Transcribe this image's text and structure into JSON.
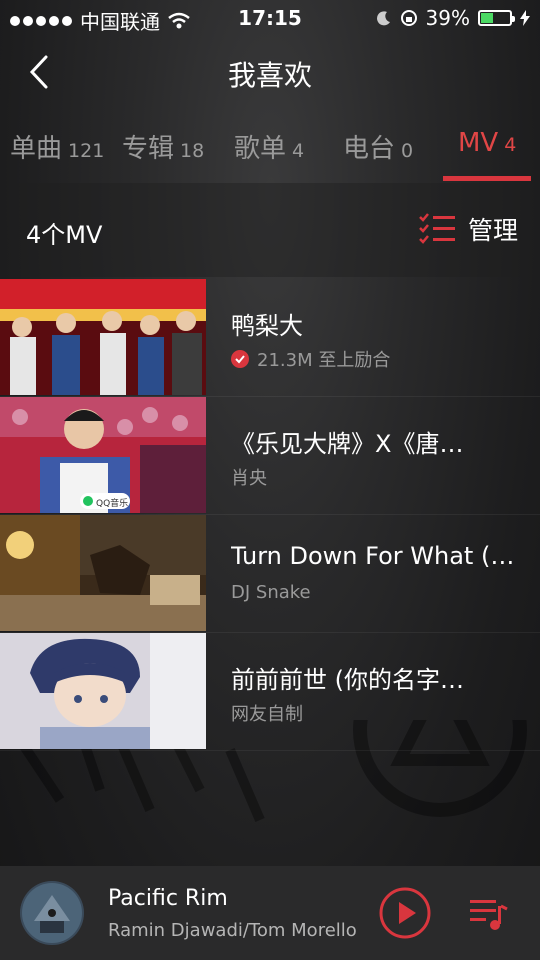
{
  "status_bar": {
    "carrier": "中国联通",
    "time": "17:15",
    "battery": "39%"
  },
  "header": {
    "title": "我喜欢"
  },
  "tabs": [
    {
      "label": "单曲",
      "count": "121"
    },
    {
      "label": "专辑",
      "count": "18"
    },
    {
      "label": "歌单",
      "count": "4"
    },
    {
      "label": "电台",
      "count": "0"
    },
    {
      "label": "MV",
      "count": "4"
    }
  ],
  "subbar": {
    "count_label": "4个MV",
    "manage_label": "管理"
  },
  "mv_list": [
    {
      "title": "鸭梨大",
      "subtitle": "21.3M 至上励合",
      "verified": true,
      "thumb": "stage-group"
    },
    {
      "title": "《乐见大牌》X《唐…",
      "subtitle": "肖央",
      "verified": false,
      "thumb": "host-show"
    },
    {
      "title": "Turn Down For What (…",
      "subtitle": "DJ Snake",
      "verified": false,
      "thumb": "room-scene"
    },
    {
      "title": "前前前世 (你的名字…",
      "subtitle": "网友自制",
      "verified": false,
      "thumb": "anime-boy"
    }
  ],
  "thumb_badge_text": "QQ音乐",
  "player": {
    "song": "Pacific Rim",
    "artist": "Ramin Djawadi/Tom Morello"
  },
  "colors": {
    "accent": "#d9363e",
    "background": "#1e1e1f",
    "secondary_text": "#9a9a9a"
  }
}
